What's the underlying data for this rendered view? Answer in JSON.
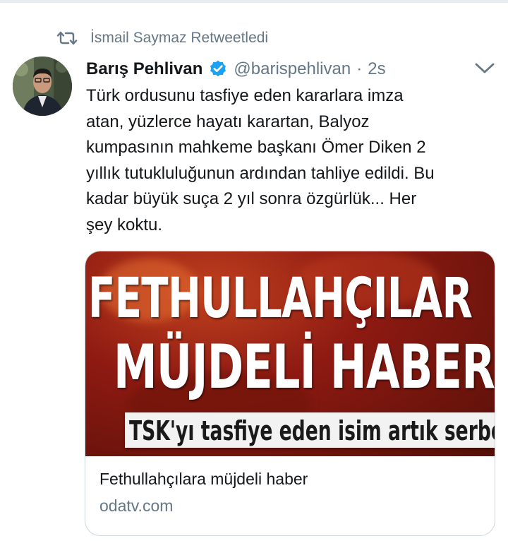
{
  "retweet": {
    "icon": "retweet-icon",
    "text": "İsmail Saymaz Retweetledi"
  },
  "tweet": {
    "author_name": "Barış Pehlivan",
    "verified_icon": "verified-badge-icon",
    "handle": "@barispehlivan",
    "separator": "·",
    "time": "2s",
    "menu_icon": "chevron-down-icon",
    "text_lines": [
      "Türk ordusunu tasfiye eden kararlara imza",
      "atan, yüzlerce hayatı karartan, Balyoz",
      "kumpasının mahkeme başkanı Ömer Diken 2",
      "yıllık tutukluluğunun ardından tahliye edildi. Bu",
      "kadar büyük suça 2 yıl sonra özgürlük... Her",
      "şey koktu."
    ]
  },
  "card": {
    "image_headline_1": "FETHULLAHÇILAR",
    "image_headline_2": "MÜJDELİ HABER",
    "image_caption": "TSK'yı tasfiye eden isim artık serbest",
    "title": "Fethullahçılara müjdeli haber",
    "domain": "odatv.com"
  },
  "colors": {
    "text_primary": "#14171a",
    "text_secondary": "#657786",
    "verified_blue": "#1da1f2",
    "border": "#ccd6dd"
  }
}
